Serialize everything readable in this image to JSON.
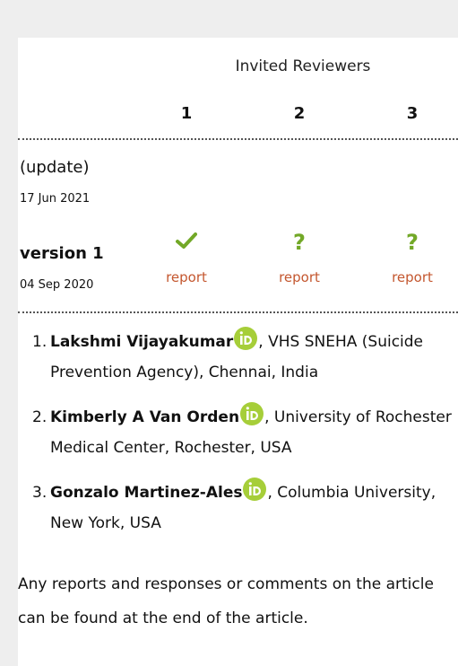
{
  "heading": "Invited Reviewers",
  "columns": [
    "1",
    "2",
    "3"
  ],
  "rows": [
    {
      "title": "(update)",
      "date": "17 Jun 2021"
    },
    {
      "title": "version 1",
      "date": "04 Sep 2020"
    }
  ],
  "version1": {
    "statuses": [
      "approved-check-icon",
      "question-icon",
      "question-icon"
    ],
    "status_glyph_question": "?",
    "report_label": "report"
  },
  "reviewers": [
    {
      "num": "1.",
      "name": "Lakshmi Vijayakumar",
      "affiliation": ", VHS SNEHA (Suicide Prevention Agency), Chennai, India"
    },
    {
      "num": "2.",
      "name": "Kimberly A Van Orden",
      "affiliation": ", University of Rochester Medical Center, Rochester, USA"
    },
    {
      "num": "3.",
      "name": "Gonzalo Martinez-Ales",
      "affiliation": ", Columbia University, New York, USA"
    }
  ],
  "footer": "Any reports and responses or comments on the article can be found at the end of the article.",
  "colors": {
    "accent_green": "#72a827",
    "report_link": "#c4572f",
    "orcid_green": "#a6ce39"
  }
}
